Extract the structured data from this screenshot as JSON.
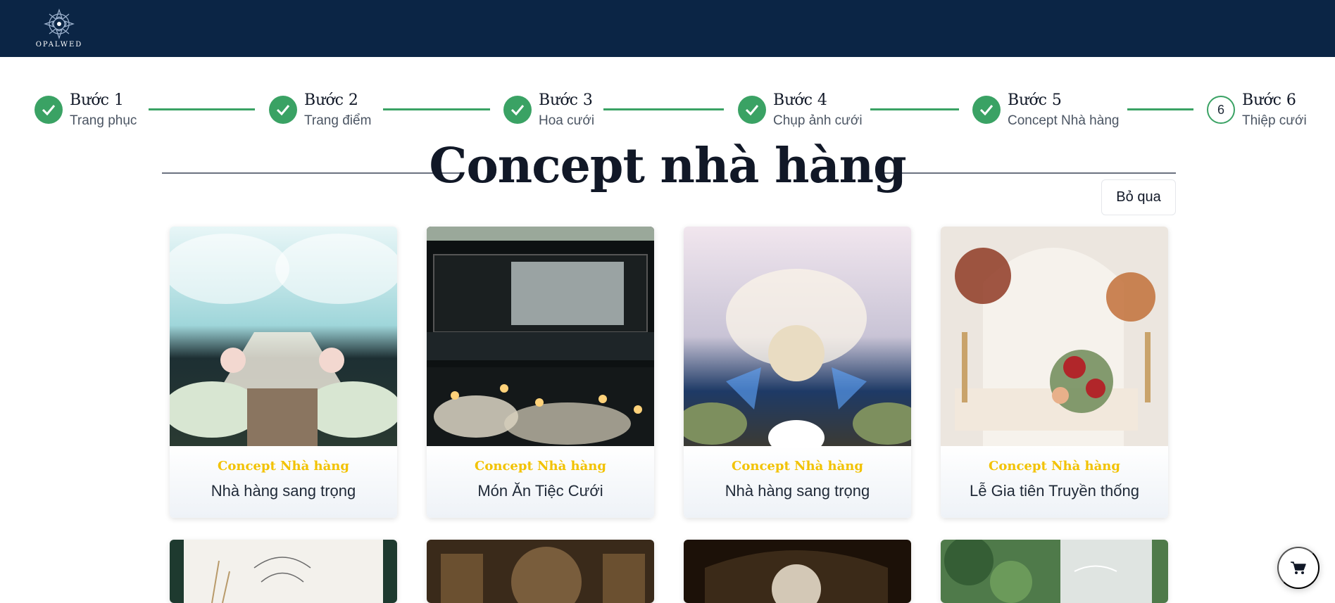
{
  "header": {
    "brand": "OPALWED"
  },
  "steps": [
    {
      "title": "Bước 1",
      "subtitle": "Trang phục",
      "status": "done"
    },
    {
      "title": "Bước 2",
      "subtitle": "Trang điểm",
      "status": "done"
    },
    {
      "title": "Bước 3",
      "subtitle": "Hoa cưới",
      "status": "done"
    },
    {
      "title": "Bước 4",
      "subtitle": "Chụp ảnh cưới",
      "status": "done"
    },
    {
      "title": "Bước 5",
      "subtitle": "Concept Nhà hàng",
      "status": "done"
    },
    {
      "title": "Bước 6",
      "subtitle": "Thiệp cưới",
      "status": "current",
      "number": "6"
    }
  ],
  "page": {
    "title": "Concept nhà hàng",
    "skip_label": "Bỏ qua"
  },
  "cards": [
    {
      "category": "Concept Nhà hàng",
      "name": "Nhà hàng sang trọng"
    },
    {
      "category": "Concept Nhà hàng",
      "name": "Món Ăn Tiệc Cưới"
    },
    {
      "category": "Concept Nhà hàng",
      "name": "Nhà hàng sang trọng"
    },
    {
      "category": "Concept Nhà hàng",
      "name": "Lễ Gia tiên Truyền thống"
    }
  ],
  "colors": {
    "header_bg": "#0b2545",
    "accent_green": "#3aa264",
    "category_gold": "#f2c200"
  },
  "icons": {
    "check": "check-icon",
    "cart": "cart-icon",
    "logo": "logo-emblem-icon"
  }
}
